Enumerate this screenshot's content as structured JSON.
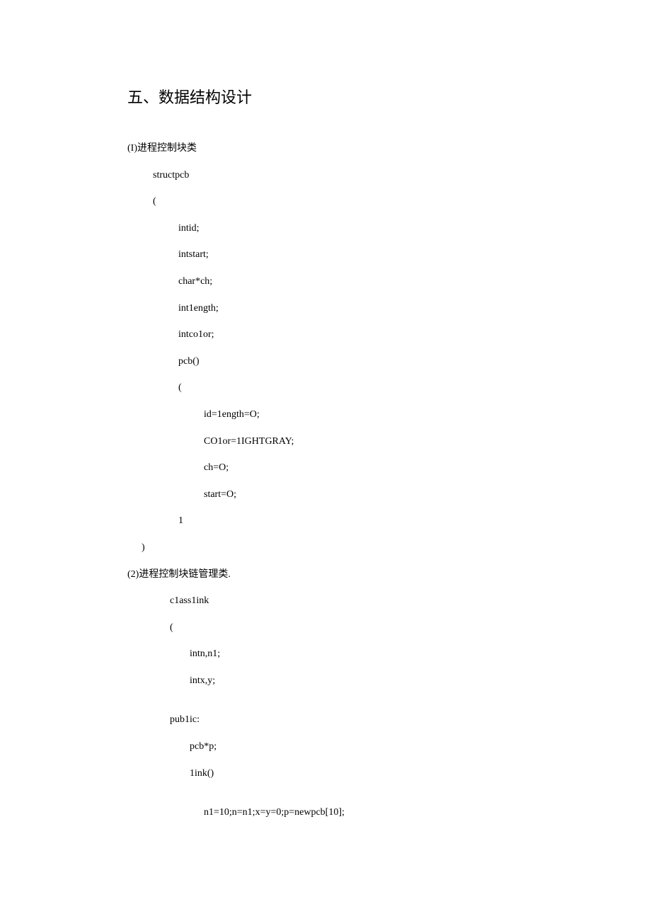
{
  "heading": "五、数据结构设计",
  "section1": {
    "title": "(I)进程控制块类",
    "lines": [
      "structpcb",
      "(",
      "intid;",
      "intstart;",
      "char*ch;",
      "int1ength;",
      "intco1or;",
      "pcb()",
      "(",
      "id=1ength=O;",
      "CO1or=1IGHTGRAY;",
      "ch=O;",
      "start=O;",
      "1",
      ")"
    ]
  },
  "section2": {
    "title": "(2)进程控制块链管理类.",
    "lines": [
      "c1ass1ink",
      "(",
      "intn,n1;",
      "intx,y;",
      "pub1ic:",
      "pcb*p;",
      "1ink()",
      "n1=10;n=n1;x=y=0;p=newpcb[10];"
    ]
  }
}
